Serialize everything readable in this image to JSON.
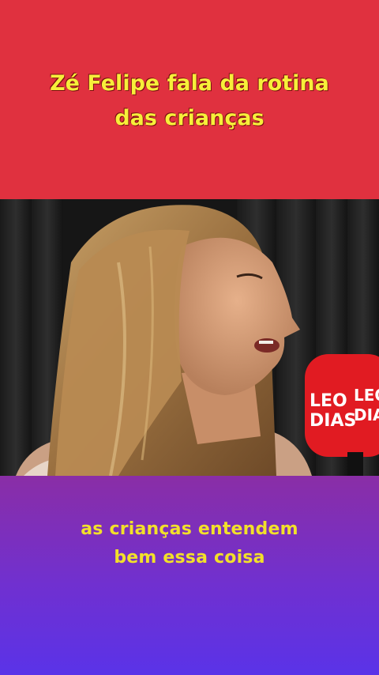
{
  "headline": {
    "line1": "Zé Felipe fala da rotina",
    "line2": "das crianças"
  },
  "video": {
    "mic_brand_line1": "LEO",
    "mic_brand_line2": "DIAS",
    "mic_brand_side_line1": "LEO",
    "mic_brand_side_line2": "DIA"
  },
  "caption": {
    "line1": "as crianças entendem",
    "line2": "bem essa coisa"
  },
  "colors": {
    "top_band": "#e0313f",
    "headline_text": "#f7ef3a",
    "caption_text": "#f2e02a",
    "mic_red": "#e11b22"
  }
}
